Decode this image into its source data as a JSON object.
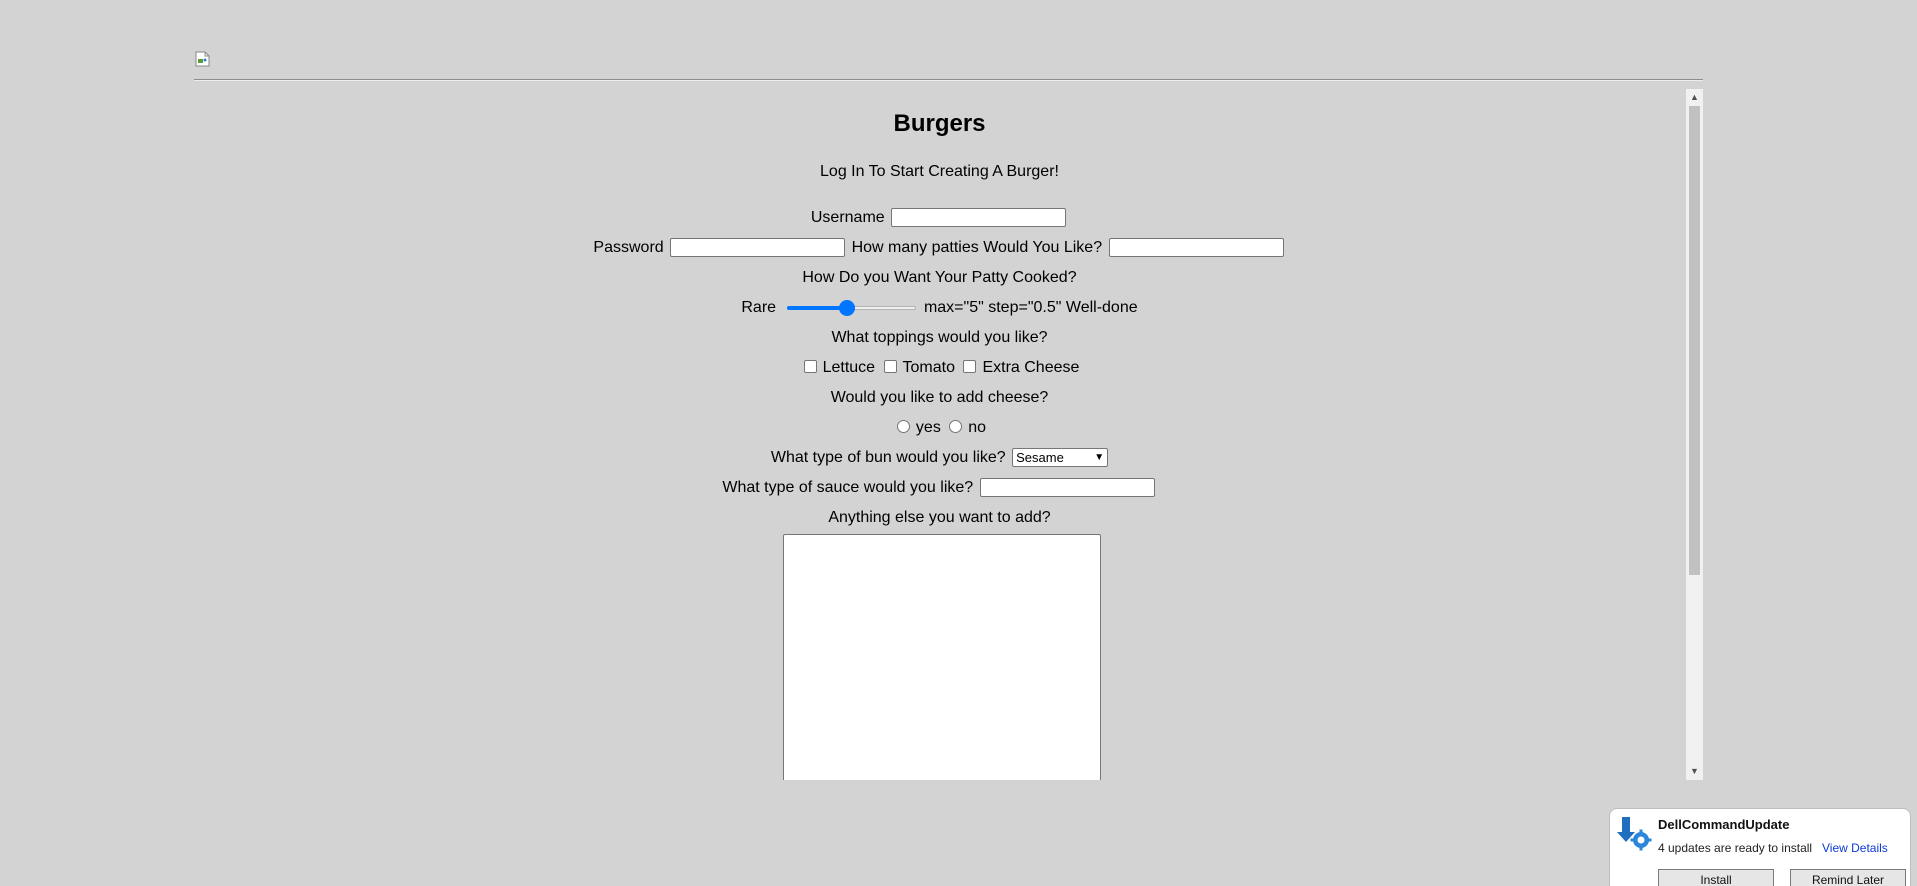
{
  "header": {
    "image_icon": "broken-image-icon"
  },
  "form": {
    "title": "Burgers",
    "subtitle": "Log In To Start Creating A Burger!",
    "username_label": "Username",
    "username_value": "",
    "password_label": "Password",
    "password_value": "",
    "patties_label": "How many patties Would You Like?",
    "patties_value": "",
    "cooked_label": "How Do you Want Your Patty Cooked?",
    "slider_min_label": "Rare",
    "slider_stray_text": "max=\"5\" step=\"0.5\"",
    "slider_max_label": "Well-done",
    "slider_level_fraction": 0.5,
    "toppings_label": "What toppings would you like?",
    "toppings": [
      {
        "label": "Lettuce",
        "checked": false
      },
      {
        "label": "Tomato",
        "checked": false
      },
      {
        "label": "Extra Cheese",
        "checked": false
      }
    ],
    "cheese_label": "Would you like to add cheese?",
    "cheese_options": [
      {
        "label": "yes",
        "checked": false
      },
      {
        "label": "no",
        "checked": false
      }
    ],
    "bun_label": "What type of bun would you like?",
    "bun_selected": "Sesame",
    "sauce_label": "What type of sauce would you like?",
    "sauce_value": "",
    "extra_label": "Anything else you want to add?",
    "extra_value": ""
  },
  "notification": {
    "app": "DellCommandUpdate",
    "message": "4 updates are ready to install",
    "link": "View Details",
    "install_button": "Install",
    "remind_button": "Remind Later",
    "icon": "dell-update-icon"
  },
  "colors": {
    "page_background": "#d3d3d3",
    "slider_accent": "#0075ff",
    "link": "#0b3ad8"
  }
}
